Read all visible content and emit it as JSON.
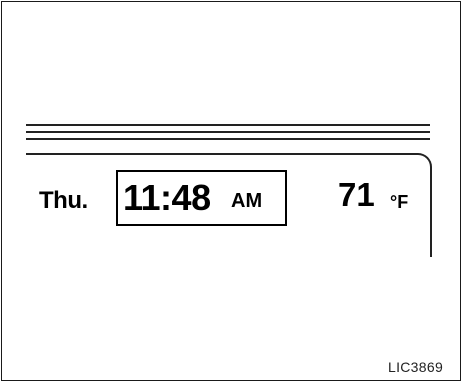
{
  "display": {
    "day": "Thu.",
    "time": "11:48",
    "meridiem": "AM",
    "temperature": "71",
    "temperature_unit": "°F"
  },
  "figure_code": "LIC3869"
}
